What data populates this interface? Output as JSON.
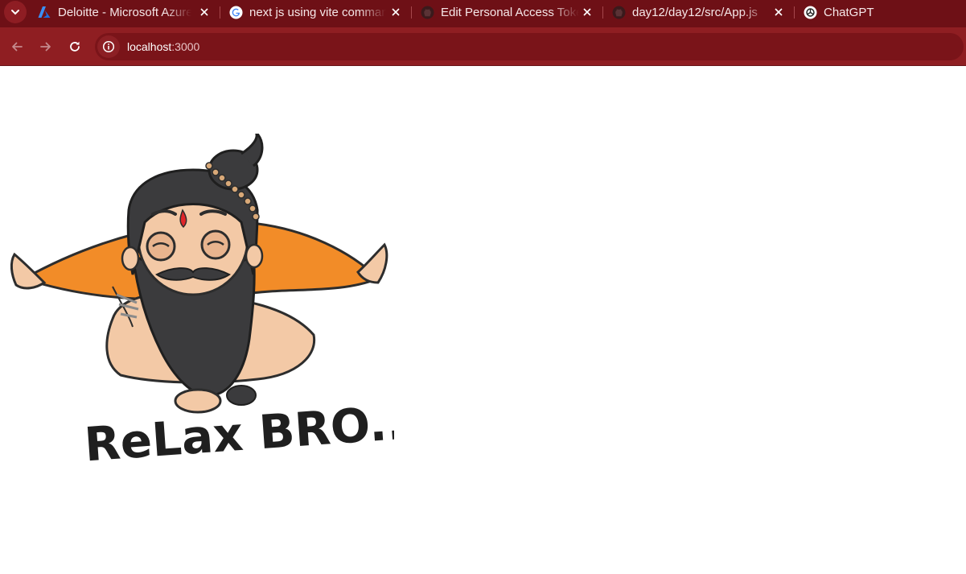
{
  "tabs": [
    {
      "title": "Deloitte - Microsoft Azure",
      "icon": "azure-icon"
    },
    {
      "title": "next js using vite command",
      "icon": "google-icon"
    },
    {
      "title": "Edit Personal Access Tokens",
      "icon": "github-icon"
    },
    {
      "title": "day12/day12/src/App.js",
      "icon": "github-icon"
    },
    {
      "title": "ChatGPT",
      "icon": "chatgpt-icon"
    }
  ],
  "toolbar": {
    "url_host": "localhost",
    "url_port": ":3000"
  },
  "page": {
    "image_text": "ReLax BRO..",
    "image_alt": "Cartoon of a bearded sadhu reclining relaxed with the text Relax Bro"
  },
  "colors": {
    "tabstrip": "#6e1016",
    "toolbar": "#8f1e22",
    "saffron": "#f28c28",
    "beard": "#3b3b3d",
    "skin": "#f3c9a6"
  }
}
